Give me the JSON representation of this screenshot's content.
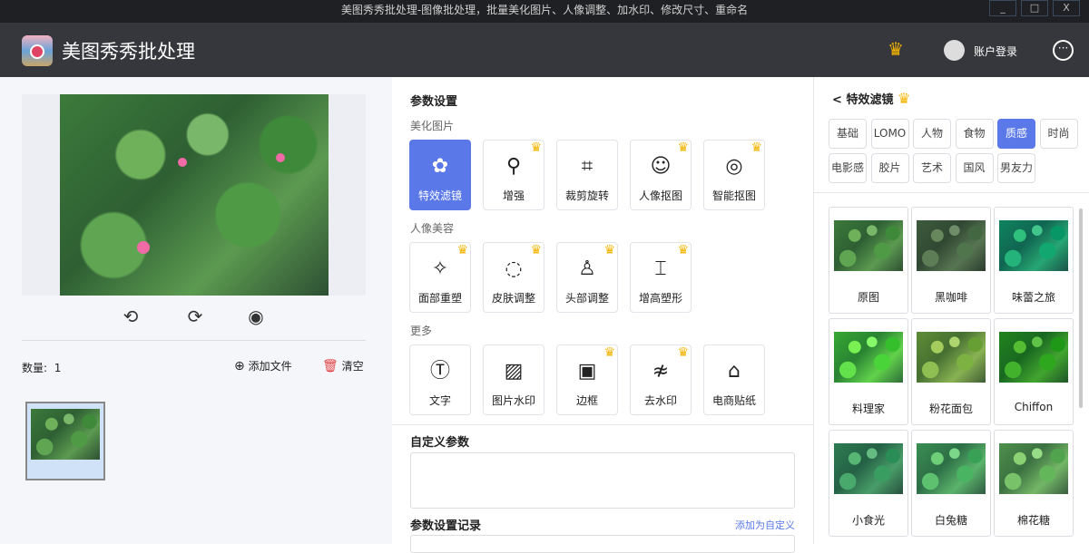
{
  "window": {
    "title": "美图秀秀批处理-图像批处理，批量美化图片、人像调整、加水印、修改尺寸、重命名",
    "min": "_",
    "max": "□",
    "close": "X"
  },
  "header": {
    "app_name": "美图秀秀批处理",
    "vip_icon": "crown-icon",
    "account": "账户登录",
    "more": "···"
  },
  "left": {
    "count_label": "数量:",
    "count": "1",
    "add_file": "添加文件",
    "clear": "清空",
    "tools": [
      "rotate-left-icon",
      "rotate-right-icon",
      "preview-eye-icon"
    ]
  },
  "params": {
    "title": "参数设置",
    "sections": [
      {
        "label": "美化图片",
        "items": [
          {
            "label": "特效滤镜",
            "icon": "✿",
            "crown": false,
            "active": true
          },
          {
            "label": "增强",
            "icon": "⚲",
            "crown": true
          },
          {
            "label": "裁剪旋转",
            "icon": "⌗",
            "crown": false
          },
          {
            "label": "人像抠图",
            "icon": "☺",
            "crown": true
          },
          {
            "label": "智能抠图",
            "icon": "◎",
            "crown": true
          }
        ]
      },
      {
        "label": "人像美容",
        "items": [
          {
            "label": "面部重塑",
            "icon": "✧",
            "crown": true
          },
          {
            "label": "皮肤调整",
            "icon": "◌",
            "crown": true
          },
          {
            "label": "头部调整",
            "icon": "♙",
            "crown": true
          },
          {
            "label": "增高塑形",
            "icon": "⌶",
            "crown": true
          }
        ]
      },
      {
        "label": "更多",
        "items": [
          {
            "label": "文字",
            "icon": "Ⓣ",
            "crown": false
          },
          {
            "label": "图片水印",
            "icon": "▨",
            "crown": false
          },
          {
            "label": "边框",
            "icon": "▣",
            "crown": true
          },
          {
            "label": "去水印",
            "icon": "≉",
            "crown": true
          },
          {
            "label": "电商贴纸",
            "icon": "⌂",
            "crown": false
          }
        ]
      }
    ],
    "custom_title": "自定义参数",
    "history_title": "参数设置记录",
    "add_custom": "添加为自定义"
  },
  "filters": {
    "back": "<",
    "title": "特效滤镜",
    "categories": [
      "基础",
      "LOMO",
      "人物",
      "食物",
      "质感",
      "时尚",
      "电影感",
      "胶片",
      "艺术",
      "国风",
      "男友力"
    ],
    "active_category": "质感",
    "items": [
      "原图",
      "黑咖啡",
      "味蕾之旅",
      "料理家",
      "粉花面包",
      "Chiffon",
      "小食光",
      "白兔糖",
      "棉花糖"
    ]
  },
  "colors": {
    "accent": "#5a78e8",
    "crown": "#f5b400",
    "header": "#36373c"
  }
}
